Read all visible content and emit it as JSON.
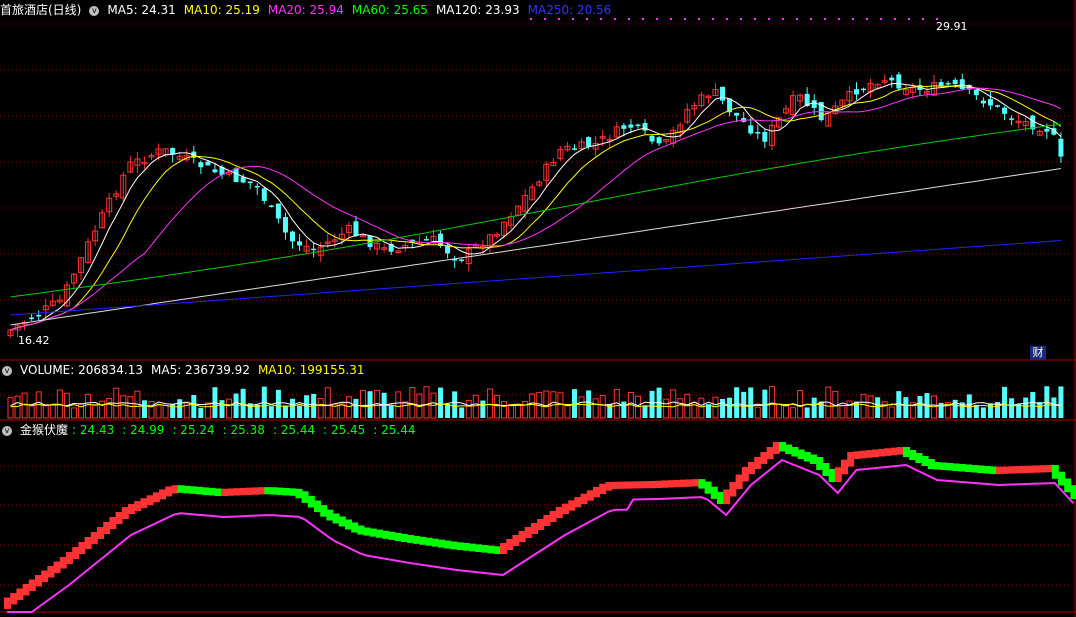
{
  "main": {
    "title": "首旅酒店(日线)",
    "ma": [
      {
        "label": "MA5: 24.31",
        "color": "#ffffff"
      },
      {
        "label": "MA10: 25.19",
        "color": "#ffff00"
      },
      {
        "label": "MA20: 25.94",
        "color": "#ff33ff"
      },
      {
        "label": "MA60: 25.65",
        "color": "#00ff00"
      },
      {
        "label": "MA120: 23.93",
        "color": "#ffffff"
      },
      {
        "label": "MA250: 20.56",
        "color": "#3333ff"
      }
    ],
    "high_label": "29.91",
    "low_label": "16.42",
    "cai_label": "财"
  },
  "volume": {
    "items": [
      {
        "label": "VOLUME: 206834.13",
        "color": "#ffffff"
      },
      {
        "label": "MA5: 236739.92",
        "color": "#ffffff"
      },
      {
        "label": "MA10: 199155.31",
        "color": "#ffff00"
      }
    ]
  },
  "indicator": {
    "title": "金猴伏魔",
    "values": [
      {
        "label": ": 24.43",
        "color": "#00ff00"
      },
      {
        "label": ": 24.99",
        "color": "#00ff00"
      },
      {
        "label": ": 25.24",
        "color": "#00ff00"
      },
      {
        "label": ": 25.38",
        "color": "#00ff00"
      },
      {
        "label": ": 25.44",
        "color": "#00ff00"
      },
      {
        "label": ": 25.45",
        "color": "#00ff00"
      },
      {
        "label": ": 25.44",
        "color": "#00ff00"
      }
    ]
  },
  "colors": {
    "up": "#ff3333",
    "down": "#54ffff",
    "grid": "#8b0000",
    "green": "#00ff00",
    "magenta": "#ff33ff"
  }
}
